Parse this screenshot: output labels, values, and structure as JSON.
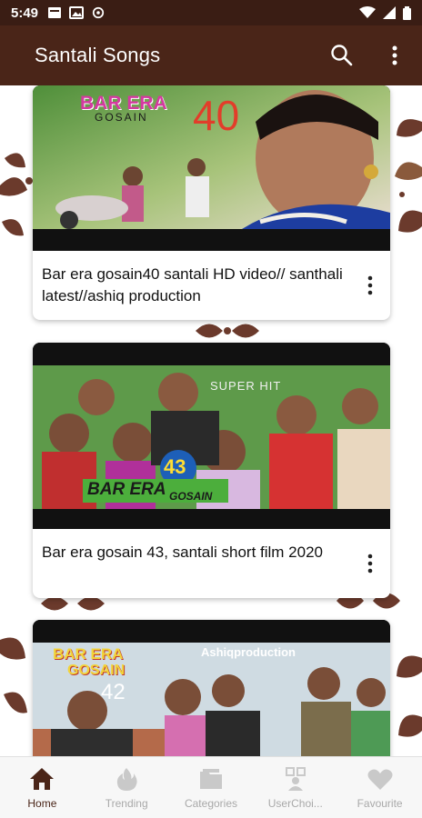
{
  "status_bar": {
    "time": "5:49"
  },
  "app_bar": {
    "title": "Santali Songs"
  },
  "cards": [
    {
      "title": "Bar era gosain40 santali HD video// santhali latest//ashiq production",
      "thumb_text_1": "BAR ERA",
      "thumb_text_2": "GOSAIN",
      "thumb_text_3": "40"
    },
    {
      "title": "Bar era gosain 43, santali short film 2020",
      "thumb_text_1": "SUPER HIT",
      "thumb_text_2": "43",
      "thumb_text_3": "BAR ERA",
      "thumb_text_4": "GOSAIN"
    },
    {
      "thumb_text_1": "BAR ERA",
      "thumb_text_2": "GOSAIN",
      "thumb_text_3": "42",
      "thumb_text_4": "Ashiqproduction"
    }
  ],
  "bottom_nav": [
    {
      "label": "Home",
      "icon": "home-icon",
      "active": true
    },
    {
      "label": "Trending",
      "icon": "fire-icon",
      "active": false
    },
    {
      "label": "Categories",
      "icon": "folder-icon",
      "active": false
    },
    {
      "label": "UserChoi...",
      "icon": "user-choice-icon",
      "active": false
    },
    {
      "label": "Favourite",
      "icon": "heart-icon",
      "active": false
    }
  ],
  "colors": {
    "app_bar": "#4a2518",
    "status_bar": "#3a1d14",
    "accent": "#4a2518",
    "decor": "#6b3a2c"
  }
}
